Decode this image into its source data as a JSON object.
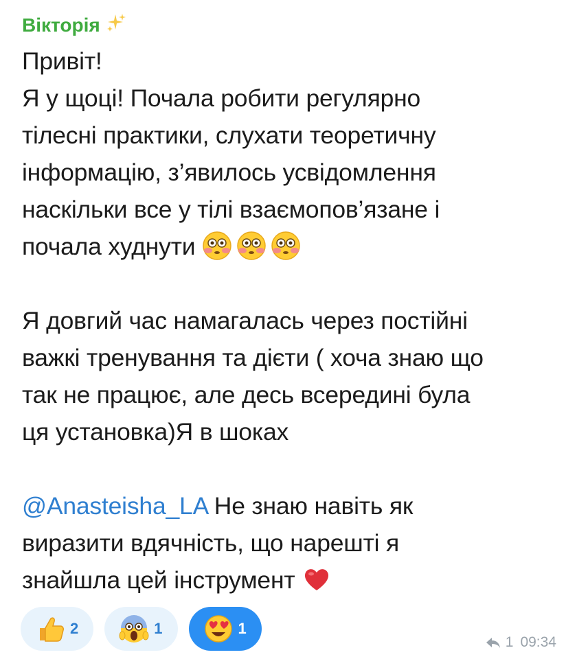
{
  "sender": {
    "name": "Вікторія",
    "badge_icon": "sparkles-icon"
  },
  "message": {
    "lines": [
      "Привіт!",
      "Я у щоці! Почала робити регулярно",
      "тілесні практики, слухати теоретичну",
      "інформацію, з’явилось усвідомлення",
      "наскільки все у тілі взаємопов’язане і",
      "почала худнути"
    ],
    "line6_emoji": "flushed-face-icon",
    "paragraph2": [
      "Я довгий час намагалась через постійні",
      "важкі тренування та дієти ( хоча знаю що",
      "так не працює, але десь всередині була",
      "ця установка)Я в шоках"
    ],
    "mention": "@Anasteisha_LA",
    "paragraph3_first_rest": " Не знаю навіть як",
    "paragraph3": [
      "виразити вдячність, що нарешті я",
      "знайшла цей інструмент"
    ],
    "paragraph3_end_emoji": "red-heart-icon"
  },
  "reactions": [
    {
      "icon": "thumbs-up-icon",
      "count": "2",
      "active": false
    },
    {
      "icon": "screaming-face-icon",
      "count": "1",
      "active": false
    },
    {
      "icon": "heart-eyes-face-icon",
      "count": "1",
      "active": true
    }
  ],
  "meta": {
    "replies": "1",
    "time": "09:34",
    "reply_icon": "reply-arrow-icon"
  },
  "colors": {
    "sender": "#3fab3f",
    "mention": "#2f7fd0",
    "active_reaction": "#2b8ff3",
    "reaction_bg": "#e8f3fc"
  }
}
